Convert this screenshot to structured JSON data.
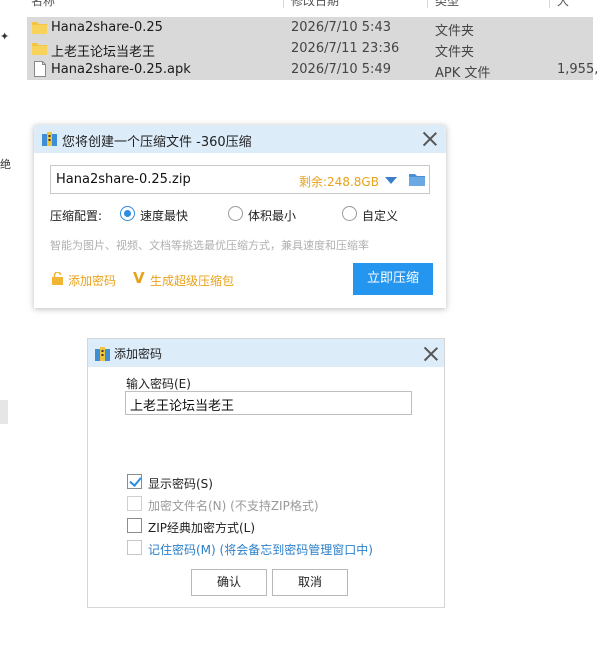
{
  "explorer": {
    "header": {
      "name": "名称",
      "date": "修改日期",
      "type": "类型",
      "size": "大"
    },
    "left_glyphs": [
      "✦",
      "绝"
    ],
    "files": [
      {
        "name": "Hana2share-0.25",
        "date": "2026/7/10 5:43",
        "type": "文件夹",
        "size": "",
        "icon": "folder-icon"
      },
      {
        "name": "上老王论坛当老王",
        "date": "2026/7/11 23:36",
        "type": "文件夹",
        "size": "",
        "icon": "folder-icon"
      },
      {
        "name": "Hana2share-0.25.apk",
        "date": "2026/7/10 5:49",
        "type": "APK 文件",
        "size": "1,955,",
        "icon": "file-icon"
      }
    ]
  },
  "compress_dialog": {
    "title": "您将创建一个压缩文件 -360压缩",
    "path": "Hana2share-0.25.zip",
    "remaining": "剩余:248.8GB",
    "config_label": "压缩配置:",
    "options": [
      {
        "label": "速度最快",
        "selected": true
      },
      {
        "label": "体积最小",
        "selected": false
      },
      {
        "label": "自定义",
        "selected": false
      }
    ],
    "hint": "智能为图片、视频、文档等挑选最优压缩方式，兼具速度和压缩率",
    "add_password": "添加密码",
    "super_package": "生成超级压缩包",
    "compress_now": "立即压缩",
    "accent_color": "#2596f0",
    "highlight_color": "#e8a21a"
  },
  "password_dialog": {
    "title": "添加密码",
    "input_label": "输入密码(E)",
    "password_value": "上老王论坛当老王",
    "checkboxes": [
      {
        "label": "显示密码(S)",
        "checked": true,
        "disabled": false
      },
      {
        "label": "加密文件名(N) (不支持ZIP格式)",
        "checked": false,
        "disabled": true
      },
      {
        "label": "ZIP经典加密方式(L)",
        "checked": false,
        "disabled": false
      },
      {
        "label": "记住密码(M) (将会备忘到密码管理窗口中)",
        "checked": false,
        "disabled": false
      }
    ],
    "ok_label": "确认",
    "cancel_label": "取消"
  }
}
